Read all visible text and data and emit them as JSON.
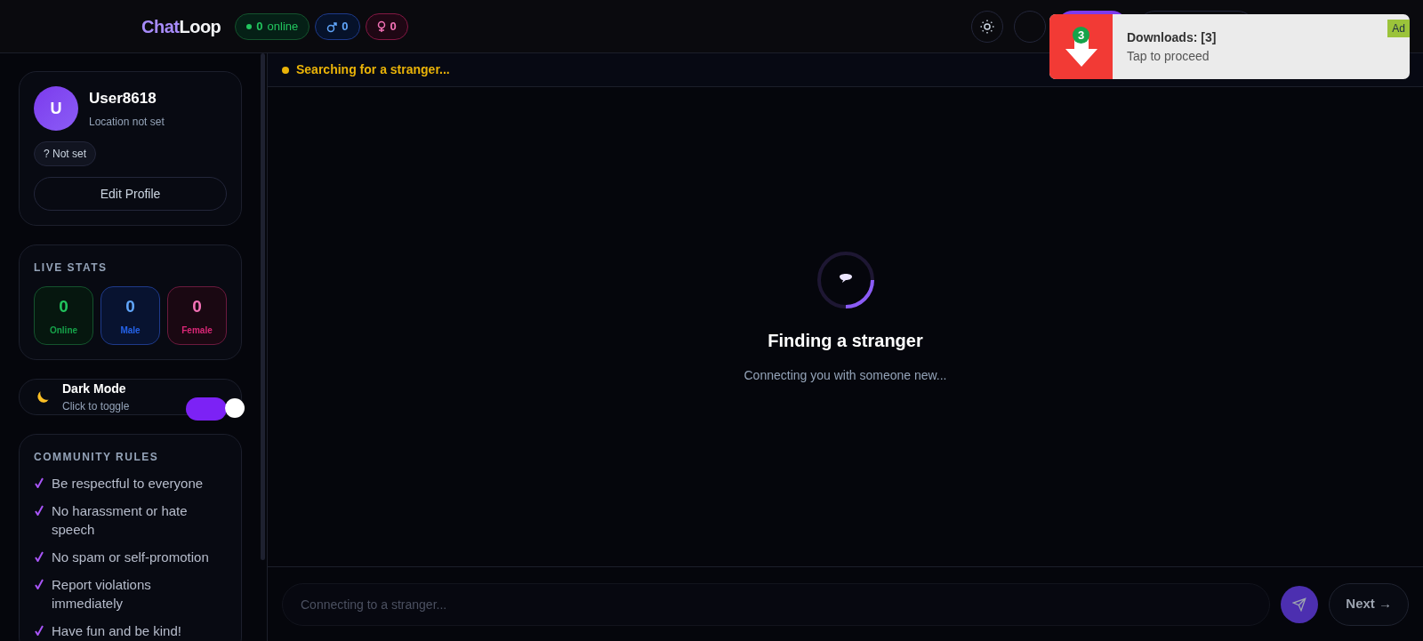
{
  "header": {
    "logo": {
      "part1": "Chat",
      "part2": "Loop"
    },
    "counters": [
      {
        "kind": "online",
        "value": "0",
        "label": "online"
      },
      {
        "kind": "male",
        "value": "0"
      },
      {
        "kind": "female",
        "value": "0"
      }
    ]
  },
  "profile": {
    "avatar": "U",
    "name": "User8618",
    "location": "Location not set",
    "gender": "? Not set",
    "edit_button": "Edit Profile"
  },
  "live_stats": {
    "title": "LIVE STATS",
    "items": [
      {
        "kind": "online",
        "value": "0",
        "label": "Online"
      },
      {
        "kind": "male",
        "value": "0",
        "label": "Male"
      },
      {
        "kind": "female",
        "value": "0",
        "label": "Female"
      }
    ]
  },
  "dark_mode": {
    "title": "Dark Mode",
    "subtitle": "Click to toggle",
    "on": true
  },
  "rules": {
    "title": "COMMUNITY RULES",
    "items": [
      "Be respectful to everyone",
      "No harassment or hate speech",
      "No spam or self-promotion",
      "Report violations immediately",
      "Have fun and be kind!"
    ]
  },
  "status": {
    "text": "Searching for a stranger..."
  },
  "search": {
    "title": "Finding a stranger",
    "subtitle": "Connecting you with someone new..."
  },
  "composer": {
    "placeholder": "Connecting to a stranger...",
    "next_button": "Next →"
  },
  "ad": {
    "badge_count": "3",
    "title": "Downloads: [3]",
    "subtitle": "Tap to proceed",
    "tag": "Ad"
  }
}
